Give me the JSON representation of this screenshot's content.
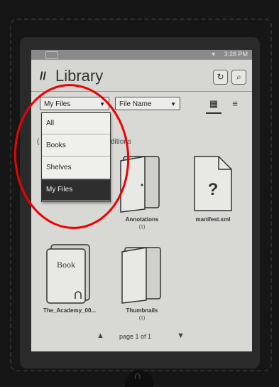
{
  "header": {
    "logo_glyph": "//",
    "title": "Library",
    "refresh_icon": "refresh-icon",
    "search_icon": "search-icon"
  },
  "status": {
    "time": "3:28 PM"
  },
  "toolbar": {
    "filter_selected": "My Files",
    "sort_selected": "File Name",
    "grid_view_glyph": "▦",
    "list_view_glyph": "≡"
  },
  "filter_menu": {
    "items": [
      "All",
      "Books",
      "Shelves",
      "My Files"
    ],
    "selected": "My Files"
  },
  "behind_menu_text": {
    "left": "(",
    "right": "ditions"
  },
  "items": [
    {
      "label": "Annotations",
      "count": "(1)",
      "icon": "folder-icon"
    },
    {
      "label": "manifest.xml",
      "count": "",
      "icon": "unknown-file-icon",
      "glyph": "?"
    },
    {
      "label": "The_Academy_00...",
      "count": "",
      "icon": "book-icon",
      "glyph": "Book"
    },
    {
      "label": "Thumbnails",
      "count": "(1)",
      "icon": "folder-icon"
    }
  ],
  "pager": {
    "text": "page 1 of 1"
  },
  "annotation": {
    "highlight_color": "#e00000"
  }
}
